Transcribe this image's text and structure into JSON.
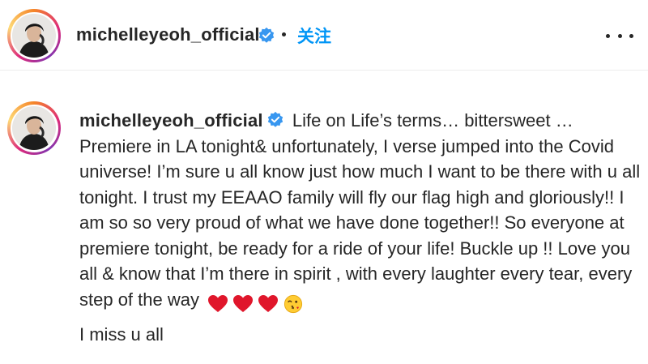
{
  "header": {
    "username": "michelleyeoh_official",
    "follow_label": "关注",
    "verified_icon": "verified-badge-icon",
    "more_icon": "more-options-icon"
  },
  "post": {
    "username": "michelleyeoh_official",
    "caption": "Life on Life’s terms… bittersweet … Premiere in LA tonight& unfortunately, I verse jumped into the Covid universe! I’m sure u all know just how much I want to be there with u all tonight. I trust my EEAAO family will fly our flag high and gloriously!! I am so so very proud of what we have done together!! So everyone at premiere tonight, be ready for a ride of your life! Buckle up !! Love you all & know that I’m there in spirit , with every laughter every tear, every step of the way",
    "emojis": [
      "red-heart-icon",
      "red-heart-icon",
      "red-heart-icon",
      "face-blowing-kiss-icon"
    ],
    "closing_line": "I miss u all"
  },
  "colors": {
    "accent": "#0095f6",
    "text": "#262626",
    "heart": "#e0162b"
  }
}
